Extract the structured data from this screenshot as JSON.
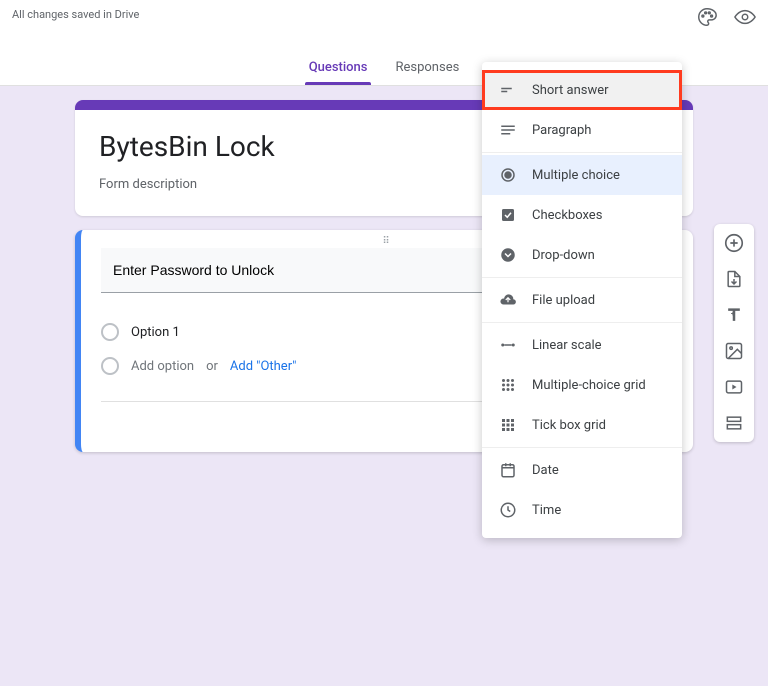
{
  "topbar": {
    "save_status": "All changes saved in Drive"
  },
  "tabs": {
    "questions": "Questions",
    "responses": "Responses"
  },
  "form": {
    "title": "BytesBin Lock",
    "description": "Form description"
  },
  "question": {
    "title": "Enter Password to Unlock",
    "option1": "Option 1",
    "add_option": "Add option",
    "or": "or",
    "add_other": "Add \"Other\""
  },
  "type_menu": {
    "items": [
      {
        "label": "Short answer"
      },
      {
        "label": "Paragraph"
      },
      {
        "label": "Multiple choice"
      },
      {
        "label": "Checkboxes"
      },
      {
        "label": "Drop-down"
      },
      {
        "label": "File upload"
      },
      {
        "label": "Linear scale"
      },
      {
        "label": "Multiple-choice grid"
      },
      {
        "label": "Tick box grid"
      },
      {
        "label": "Date"
      },
      {
        "label": "Time"
      }
    ]
  }
}
